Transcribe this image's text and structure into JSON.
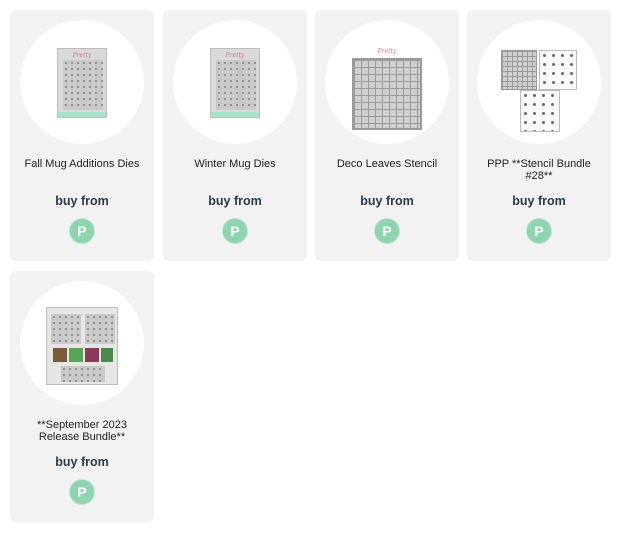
{
  "products": [
    {
      "title": "Fall Mug Additions Dies",
      "buy_label": "buy from",
      "store_letter": "P"
    },
    {
      "title": "Winter Mug Dies",
      "buy_label": "buy from",
      "store_letter": "P"
    },
    {
      "title": "Deco Leaves Stencil",
      "buy_label": "buy from",
      "store_letter": "P"
    },
    {
      "title": "PPP **Stencil Bundle #28**",
      "buy_label": "buy from",
      "store_letter": "P"
    },
    {
      "title": "**September 2023 Release Bundle**",
      "buy_label": "buy from",
      "store_letter": "P"
    }
  ],
  "colors": {
    "store_badge": "#8fd3b0",
    "card_bg": "#f2f2f2",
    "label": "#2b3a4a"
  }
}
